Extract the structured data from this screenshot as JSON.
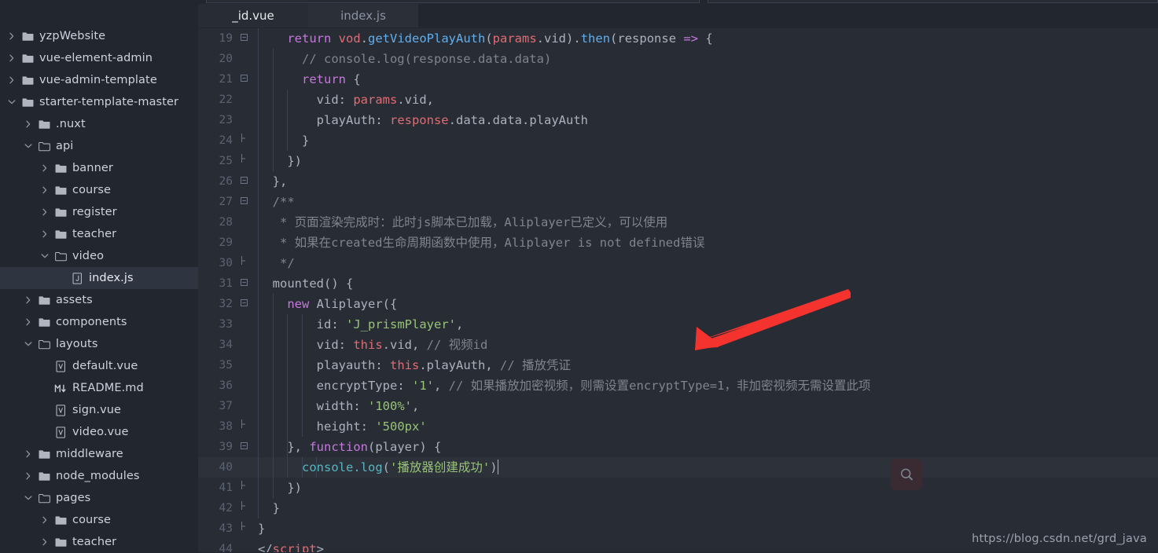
{
  "window": {
    "theme_bg": "#282c34",
    "sidebar_bg": "#22262e",
    "accent": "#61afef"
  },
  "sidebar": {
    "name": "project-explorer",
    "items": [
      {
        "label": "yzpWebsite",
        "indent": 0,
        "type": "folder",
        "state": "collapsed",
        "selected": false
      },
      {
        "label": "vue-element-admin",
        "indent": 0,
        "type": "folder",
        "state": "collapsed",
        "selected": false
      },
      {
        "label": "vue-admin-template",
        "indent": 0,
        "type": "folder",
        "state": "collapsed",
        "selected": false
      },
      {
        "label": "starter-template-master",
        "indent": 0,
        "type": "folder",
        "state": "expanded",
        "selected": false
      },
      {
        "label": ".nuxt",
        "indent": 1,
        "type": "folder",
        "state": "collapsed",
        "selected": false
      },
      {
        "label": "api",
        "indent": 1,
        "type": "folderopen",
        "state": "expanded",
        "selected": false
      },
      {
        "label": "banner",
        "indent": 2,
        "type": "folder",
        "state": "collapsed",
        "selected": false
      },
      {
        "label": "course",
        "indent": 2,
        "type": "folder",
        "state": "collapsed",
        "selected": false
      },
      {
        "label": "register",
        "indent": 2,
        "type": "folder",
        "state": "collapsed",
        "selected": false
      },
      {
        "label": "teacher",
        "indent": 2,
        "type": "folder",
        "state": "collapsed",
        "selected": false
      },
      {
        "label": "video",
        "indent": 2,
        "type": "folderopen",
        "state": "expanded",
        "selected": false
      },
      {
        "label": "index.js",
        "indent": 3,
        "type": "js",
        "state": "none",
        "selected": true
      },
      {
        "label": "assets",
        "indent": 1,
        "type": "folder",
        "state": "collapsed",
        "selected": false
      },
      {
        "label": "components",
        "indent": 1,
        "type": "folder",
        "state": "collapsed",
        "selected": false
      },
      {
        "label": "layouts",
        "indent": 1,
        "type": "folderopen",
        "state": "expanded",
        "selected": false
      },
      {
        "label": "default.vue",
        "indent": 2,
        "type": "vue",
        "state": "none",
        "selected": false
      },
      {
        "label": "README.md",
        "indent": 2,
        "type": "md",
        "state": "none",
        "selected": false
      },
      {
        "label": "sign.vue",
        "indent": 2,
        "type": "vue",
        "state": "none",
        "selected": false
      },
      {
        "label": "video.vue",
        "indent": 2,
        "type": "vue",
        "state": "none",
        "selected": false
      },
      {
        "label": "middleware",
        "indent": 1,
        "type": "folder",
        "state": "collapsed",
        "selected": false
      },
      {
        "label": "node_modules",
        "indent": 1,
        "type": "folder",
        "state": "collapsed",
        "selected": false
      },
      {
        "label": "pages",
        "indent": 1,
        "type": "folderopen",
        "state": "expanded",
        "selected": false
      },
      {
        "label": "course",
        "indent": 2,
        "type": "folder",
        "state": "collapsed",
        "selected": false
      },
      {
        "label": "teacher",
        "indent": 2,
        "type": "folder",
        "state": "collapsed",
        "selected": false
      }
    ]
  },
  "tabs": [
    {
      "label": "_id.vue",
      "active": true
    },
    {
      "label": "index.js",
      "active": false
    }
  ],
  "editor": {
    "first_line_number": 19,
    "cursor_line": 40,
    "highlighted_line": 40,
    "lines": [
      {
        "n": 19,
        "fold": "minus",
        "indent": 1,
        "guides": 1,
        "tokens": [
          {
            "t": "    ",
            "c": "plain"
          },
          {
            "t": "return",
            "c": "kw"
          },
          {
            "t": " ",
            "c": "plain"
          },
          {
            "t": "vod",
            "c": "var"
          },
          {
            "t": ".",
            "c": "pun"
          },
          {
            "t": "getVideoPlayAuth",
            "c": "fn"
          },
          {
            "t": "(",
            "c": "pun"
          },
          {
            "t": "params",
            "c": "var"
          },
          {
            "t": ".",
            "c": "pun"
          },
          {
            "t": "vid",
            "c": "plain"
          },
          {
            "t": ")",
            "c": "pun"
          },
          {
            "t": ".",
            "c": "pun"
          },
          {
            "t": "then",
            "c": "fn"
          },
          {
            "t": "(",
            "c": "pun"
          },
          {
            "t": "response",
            "c": "plain"
          },
          {
            "t": " ",
            "c": "plain"
          },
          {
            "t": "=>",
            "c": "arrow"
          },
          {
            "t": " ",
            "c": "plain"
          },
          {
            "t": "{",
            "c": "pun"
          }
        ]
      },
      {
        "n": 20,
        "fold": "",
        "indent": 2,
        "guides": 2,
        "tokens": [
          {
            "t": "      // console.log(response.data.data)",
            "c": "cmt"
          }
        ]
      },
      {
        "n": 21,
        "fold": "minus",
        "indent": 2,
        "guides": 2,
        "tokens": [
          {
            "t": "      ",
            "c": "plain"
          },
          {
            "t": "return",
            "c": "kw"
          },
          {
            "t": " ",
            "c": "plain"
          },
          {
            "t": "{",
            "c": "pun"
          }
        ]
      },
      {
        "n": 22,
        "fold": "",
        "indent": 3,
        "guides": 3,
        "tokens": [
          {
            "t": "        vid",
            "c": "plain"
          },
          {
            "t": ": ",
            "c": "pun"
          },
          {
            "t": "params",
            "c": "var"
          },
          {
            "t": ".",
            "c": "pun"
          },
          {
            "t": "vid",
            "c": "plain"
          },
          {
            "t": ",",
            "c": "pun"
          }
        ]
      },
      {
        "n": 23,
        "fold": "",
        "indent": 3,
        "guides": 3,
        "tokens": [
          {
            "t": "        playAuth",
            "c": "plain"
          },
          {
            "t": ": ",
            "c": "pun"
          },
          {
            "t": "response",
            "c": "var"
          },
          {
            "t": ".",
            "c": "pun"
          },
          {
            "t": "data",
            "c": "plain"
          },
          {
            "t": ".",
            "c": "pun"
          },
          {
            "t": "data",
            "c": "plain"
          },
          {
            "t": ".",
            "c": "pun"
          },
          {
            "t": "playAuth",
            "c": "plain"
          }
        ]
      },
      {
        "n": 24,
        "fold": "end",
        "indent": 3,
        "guides": 3,
        "tokens": [
          {
            "t": "      ",
            "c": "plain"
          },
          {
            "t": "}",
            "c": "pun"
          }
        ]
      },
      {
        "n": 25,
        "fold": "end",
        "indent": 2,
        "guides": 2,
        "tokens": [
          {
            "t": "    ",
            "c": "plain"
          },
          {
            "t": "})",
            "c": "pun"
          }
        ]
      },
      {
        "n": 26,
        "fold": "minus",
        "indent": 1,
        "guides": 1,
        "tokens": [
          {
            "t": "  ",
            "c": "plain"
          },
          {
            "t": "},",
            "c": "pun"
          }
        ]
      },
      {
        "n": 27,
        "fold": "minus",
        "indent": 1,
        "guides": 1,
        "tokens": [
          {
            "t": "  /**",
            "c": "cmt"
          }
        ]
      },
      {
        "n": 28,
        "fold": "",
        "indent": 1,
        "guides": 1,
        "tokens": [
          {
            "t": "   * 页面渲染完成时：此时js脚本已加载，Aliplayer已定义，可以使用",
            "c": "cmt"
          }
        ]
      },
      {
        "n": 29,
        "fold": "",
        "indent": 1,
        "guides": 1,
        "tokens": [
          {
            "t": "   * 如果在created生命周期函数中使用，Aliplayer is not defined错误",
            "c": "cmt"
          }
        ]
      },
      {
        "n": 30,
        "fold": "end",
        "indent": 1,
        "guides": 1,
        "tokens": [
          {
            "t": "   */",
            "c": "cmt"
          }
        ]
      },
      {
        "n": 31,
        "fold": "minus",
        "indent": 0,
        "guides": 1,
        "tokens": [
          {
            "t": "  mounted",
            "c": "plain"
          },
          {
            "t": "() {",
            "c": "pun"
          }
        ]
      },
      {
        "n": 32,
        "fold": "minus",
        "indent": 2,
        "guides": 2,
        "tokens": [
          {
            "t": "    ",
            "c": "plain"
          },
          {
            "t": "new",
            "c": "kw"
          },
          {
            "t": " ",
            "c": "plain"
          },
          {
            "t": "Aliplayer",
            "c": "plain"
          },
          {
            "t": "({",
            "c": "pun"
          }
        ]
      },
      {
        "n": 33,
        "fold": "",
        "indent": 4,
        "guides": 4,
        "tokens": [
          {
            "t": "        id",
            "c": "plain"
          },
          {
            "t": ": ",
            "c": "pun"
          },
          {
            "t": "'J_prismPlayer'",
            "c": "str"
          },
          {
            "t": ",",
            "c": "pun"
          }
        ]
      },
      {
        "n": 34,
        "fold": "",
        "indent": 4,
        "guides": 4,
        "tokens": [
          {
            "t": "        vid",
            "c": "plain"
          },
          {
            "t": ": ",
            "c": "pun"
          },
          {
            "t": "this",
            "c": "var"
          },
          {
            "t": ".",
            "c": "pun"
          },
          {
            "t": "vid",
            "c": "plain"
          },
          {
            "t": ", ",
            "c": "pun"
          },
          {
            "t": "// 视频id",
            "c": "cmt"
          }
        ]
      },
      {
        "n": 35,
        "fold": "",
        "indent": 4,
        "guides": 4,
        "tokens": [
          {
            "t": "        playauth",
            "c": "plain"
          },
          {
            "t": ": ",
            "c": "pun"
          },
          {
            "t": "this",
            "c": "var"
          },
          {
            "t": ".",
            "c": "pun"
          },
          {
            "t": "playAuth",
            "c": "plain"
          },
          {
            "t": ", ",
            "c": "pun"
          },
          {
            "t": "// 播放凭证",
            "c": "cmt"
          }
        ]
      },
      {
        "n": 36,
        "fold": "",
        "indent": 4,
        "guides": 4,
        "tokens": [
          {
            "t": "        encryptType",
            "c": "plain"
          },
          {
            "t": ": ",
            "c": "pun"
          },
          {
            "t": "'1'",
            "c": "str"
          },
          {
            "t": ", ",
            "c": "pun"
          },
          {
            "t": "// 如果播放加密视频，则需设置encryptType=1，非加密视频无需设置此项",
            "c": "cmt"
          }
        ]
      },
      {
        "n": 37,
        "fold": "",
        "indent": 4,
        "guides": 4,
        "tokens": [
          {
            "t": "        width",
            "c": "plain"
          },
          {
            "t": ": ",
            "c": "pun"
          },
          {
            "t": "'100%'",
            "c": "str"
          },
          {
            "t": ",",
            "c": "pun"
          }
        ]
      },
      {
        "n": 38,
        "fold": "end",
        "indent": 4,
        "guides": 4,
        "tokens": [
          {
            "t": "        height",
            "c": "plain"
          },
          {
            "t": ": ",
            "c": "pun"
          },
          {
            "t": "'500px'",
            "c": "str"
          }
        ]
      },
      {
        "n": 39,
        "fold": "minus",
        "indent": 2,
        "guides": 3,
        "tokens": [
          {
            "t": "    ",
            "c": "plain"
          },
          {
            "t": "}, ",
            "c": "pun"
          },
          {
            "t": "function",
            "c": "kw"
          },
          {
            "t": "(",
            "c": "pun"
          },
          {
            "t": "player",
            "c": "plain"
          },
          {
            "t": ") {",
            "c": "pun"
          }
        ]
      },
      {
        "n": 40,
        "fold": "",
        "indent": 5,
        "guides": 5,
        "tokens": [
          {
            "t": "      ",
            "c": "plain"
          },
          {
            "t": "console",
            "c": "cyan"
          },
          {
            "t": ".",
            "c": "cyan"
          },
          {
            "t": "log",
            "c": "cyan"
          },
          {
            "t": "(",
            "c": "pun"
          },
          {
            "t": "'播放器创建成功'",
            "c": "str"
          },
          {
            "t": ")",
            "c": "pun"
          }
        ]
      },
      {
        "n": 41,
        "fold": "end",
        "indent": 2,
        "guides": 2,
        "tokens": [
          {
            "t": "    ",
            "c": "plain"
          },
          {
            "t": "})",
            "c": "pun"
          }
        ]
      },
      {
        "n": 42,
        "fold": "end",
        "indent": 1,
        "guides": 1,
        "tokens": [
          {
            "t": "  ",
            "c": "plain"
          },
          {
            "t": "}",
            "c": "pun"
          }
        ]
      },
      {
        "n": 43,
        "fold": "end",
        "indent": 0,
        "guides": 0,
        "tokens": [
          {
            "t": "}",
            "c": "pun"
          }
        ]
      },
      {
        "n": 44,
        "fold": "",
        "indent": 0,
        "guides": 0,
        "tokens": [
          {
            "t": "&lt;/",
            "c": "plain"
          },
          {
            "t": "script",
            "c": "tag"
          },
          {
            "t": "&gt;",
            "c": "plain"
          }
        ]
      }
    ]
  },
  "annotations": {
    "arrow": {
      "name": "red-arrow-annotation",
      "color": "#f5332e"
    }
  },
  "search_widget": {
    "icon": "search-icon",
    "label": ""
  },
  "watermark": {
    "text": "https://blog.csdn.net/grd_java"
  }
}
